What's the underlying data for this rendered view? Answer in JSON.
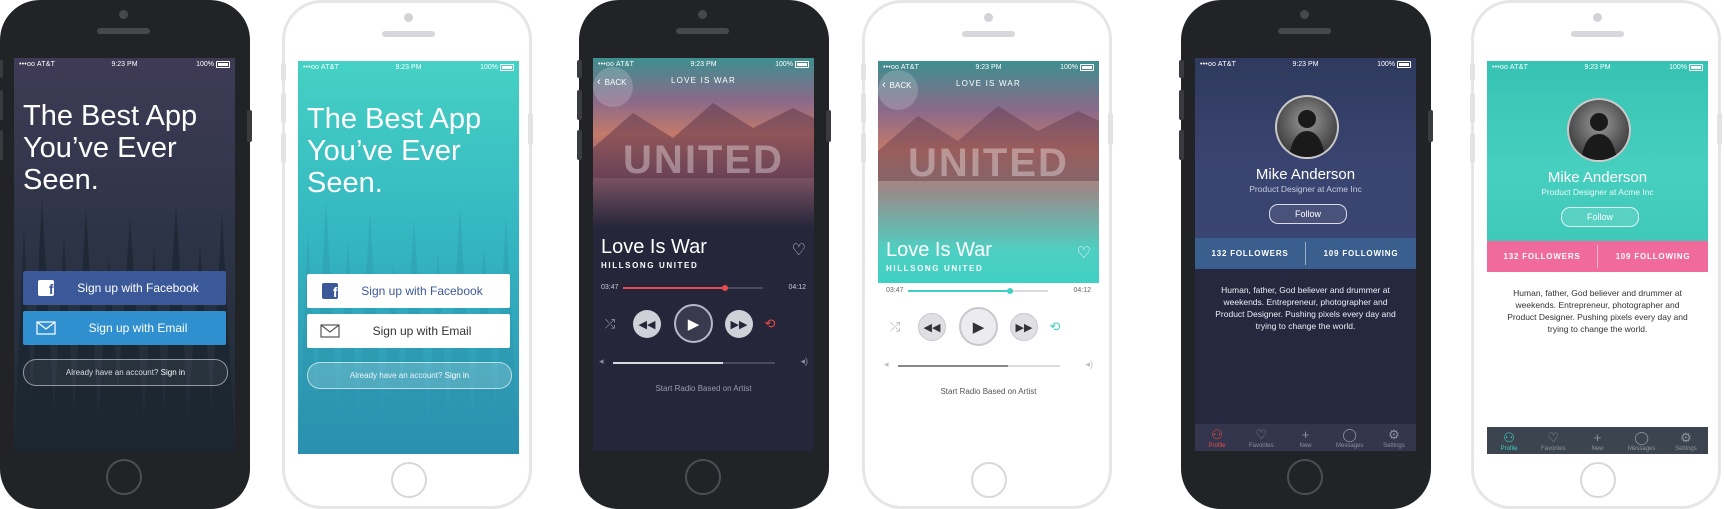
{
  "status_bar": {
    "carrier": "•••oo AT&T",
    "time": "9:23 PM",
    "battery": "100%"
  },
  "welcome": {
    "headline": "The Best App You’ve Ever Seen.",
    "facebook_label": "Sign up with Facebook",
    "email_label": "Sign up with Email",
    "signin_prompt": "Already have an account?",
    "signin_link": "Sign in"
  },
  "player": {
    "back_label": "BACK",
    "nav_title": "LOVE IS WAR",
    "album_art_text": "UNITED",
    "song_title": "Love Is War",
    "artist": "HILLSONG UNITED",
    "elapsed": "03:47",
    "remaining": "04:12",
    "progress": 0.73,
    "volume": 0.68,
    "radio_label": "Start Radio Based on Artist"
  },
  "profile": {
    "name": "Mike Anderson",
    "role": "Product Designer at Acme Inc",
    "follow_label": "Follow",
    "followers": "132 FOLLOWERS",
    "following": "109 FOLLOWING",
    "bio": "Human, father, God believer and drummer at weekends. Entrepreneur, photographer and Product Designer. Pushing pixels every day and trying to change the world.",
    "tabs": [
      {
        "label": "Profile",
        "icon": "person-icon"
      },
      {
        "label": "Favorites",
        "icon": "heart-icon"
      },
      {
        "label": "New",
        "icon": "plus-icon"
      },
      {
        "label": "Messages",
        "icon": "chat-icon"
      },
      {
        "label": "Settings",
        "icon": "gear-icon"
      }
    ]
  },
  "colors": {
    "dark_accent": "#e84a47",
    "teal_accent": "#3fd0c3",
    "facebook_blue": "#3b5998",
    "email_blue": "#2f8fcf",
    "pink": "#f06a9b",
    "stats_blue": "#3a5f8e"
  }
}
